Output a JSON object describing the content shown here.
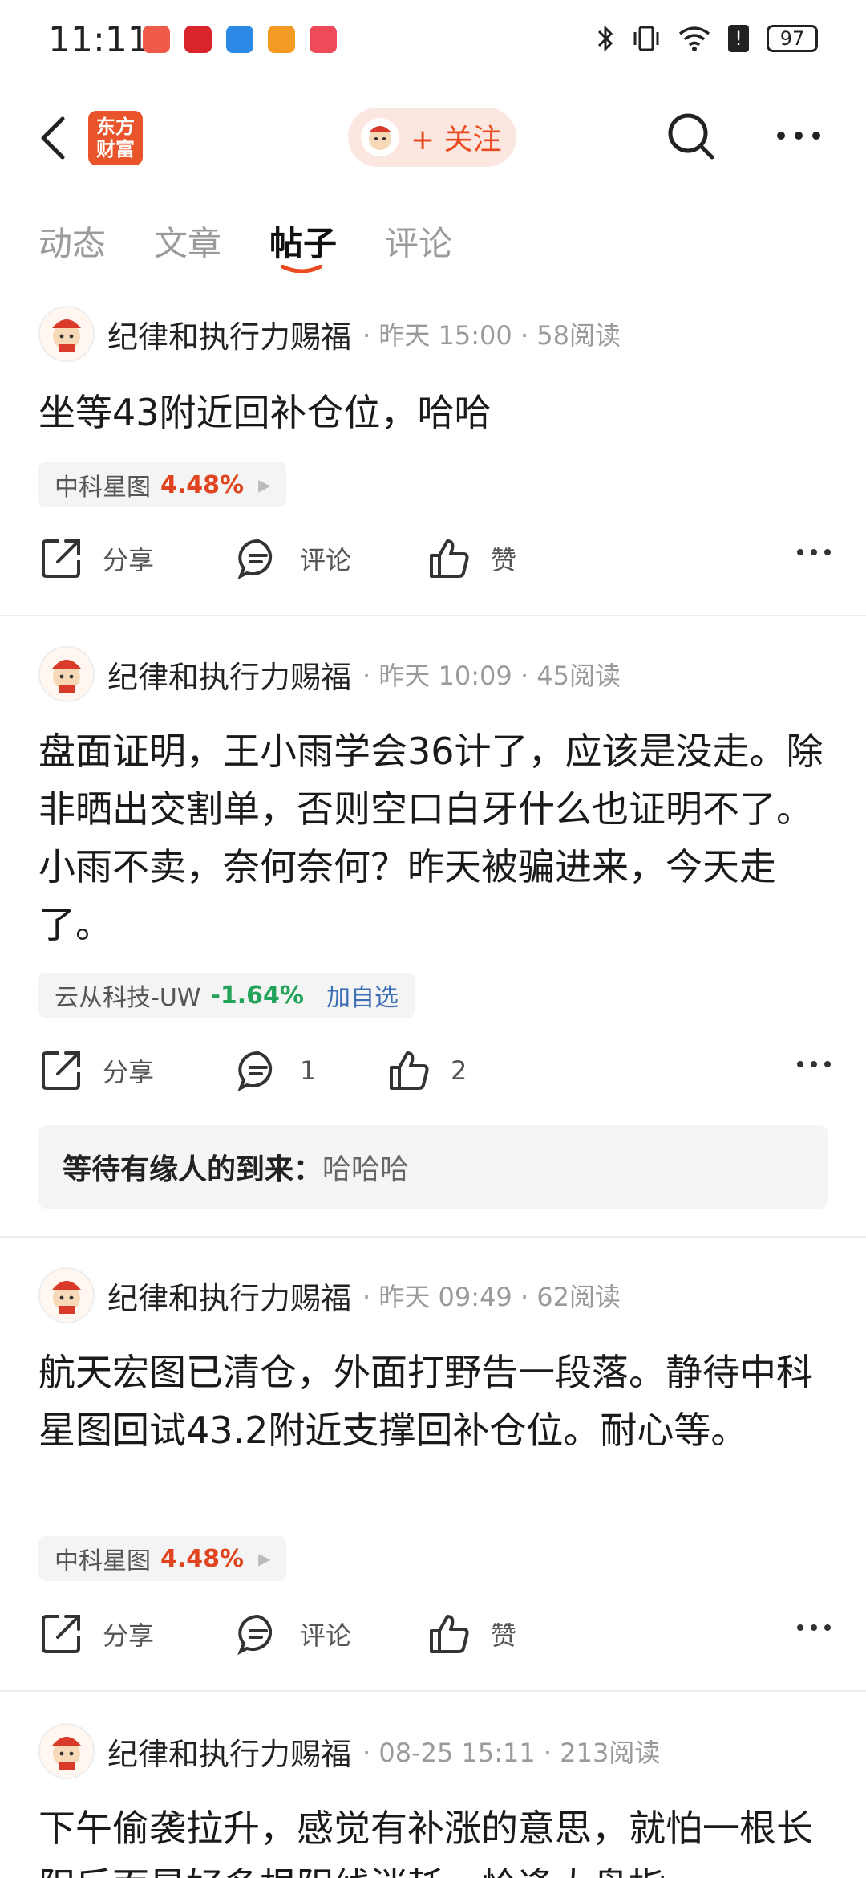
{
  "status_bar": {
    "time": "11:11",
    "battery": "97",
    "app_icons": [
      "icon-red-1",
      "icon-red-2",
      "bluetooth-app",
      "icon-orange",
      "icon-red-3"
    ],
    "colors": [
      "#ef5a4a",
      "#d8242a",
      "#2a8ae6",
      "#f59a23",
      "#ef4a5a"
    ]
  },
  "header": {
    "logo_line1": "东方",
    "logo_line2": "财富",
    "follow_label": "+ 关注"
  },
  "tabs": [
    {
      "label": "动态"
    },
    {
      "label": "文章"
    },
    {
      "label": "帖子"
    },
    {
      "label": "评论"
    }
  ],
  "posts": [
    {
      "author": "纪律和执行力赐福",
      "time": "昨天 15:00",
      "reads": "58阅读",
      "text": "坐等43附近回补仓位，哈哈",
      "stock": {
        "name": "中科星图",
        "change": "4.48%",
        "trend": "up"
      },
      "share": "分享",
      "comment": "评论",
      "like": "赞"
    },
    {
      "author": "纪律和执行力赐福",
      "time": "昨天 10:09",
      "reads": "45阅读",
      "text": "盘面证明，王小雨学会36计了，应该是没走。除非晒出交割单，否则空口白牙什么也证明不了。小雨不卖，奈何奈何？昨天被骗进来，今天走了。",
      "stock": {
        "name": "云从科技-UW",
        "change": "-1.64%",
        "trend": "down",
        "add": "加自选"
      },
      "share": "分享",
      "comment": "1",
      "like": "2",
      "reply": {
        "who": "等待有缘人的到来：",
        "text": "哈哈哈"
      }
    },
    {
      "author": "纪律和执行力赐福",
      "time": "昨天 09:49",
      "reads": "62阅读",
      "text": "航天宏图已清仓，外面打野告一段落。静待中科星图回试43.2附近支撑回补仓位。耐心等。",
      "stock": {
        "name": "中科星图",
        "change": "4.48%",
        "trend": "up"
      },
      "share": "分享",
      "comment": "评论",
      "like": "赞"
    },
    {
      "author": "纪律和执行力赐福",
      "time": "08-25 15:11",
      "reads": "213阅读",
      "text": "下午偷袭拉升，感觉有补涨的意思，就怕一根长阳后面是好多根阴线消耗，恰逢大盘指"
    }
  ]
}
